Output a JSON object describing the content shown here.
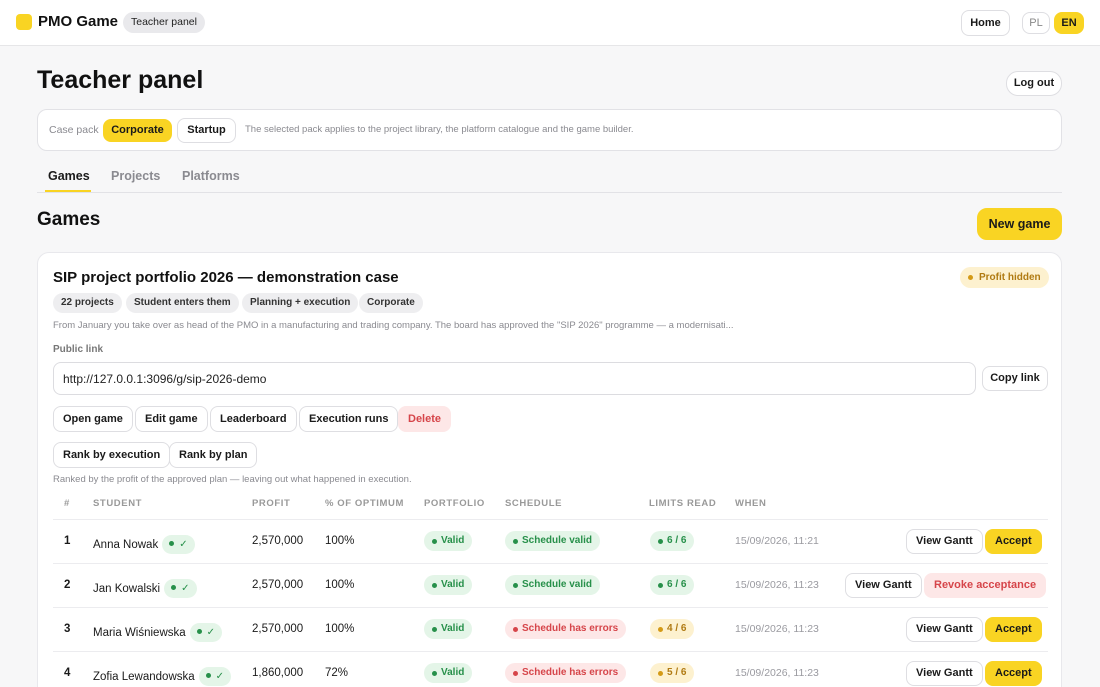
{
  "header": {
    "brand": "PMO Game",
    "panel_tag": "Teacher panel",
    "home": "Home",
    "lang_pl": "PL",
    "lang_en": "EN"
  },
  "page": {
    "title": "Teacher panel",
    "logout": "Log out"
  },
  "case_pack": {
    "label": "Case pack",
    "options": [
      "Corporate",
      "Startup"
    ],
    "selected": "Corporate",
    "note": "The selected pack applies to the project library, the platform catalogue and the game builder."
  },
  "tabs": [
    {
      "label": "Games",
      "active": true
    },
    {
      "label": "Projects",
      "active": false
    },
    {
      "label": "Platforms",
      "active": false
    }
  ],
  "games": {
    "title": "Games",
    "new_game": "New game"
  },
  "game": {
    "title": "SIP project portfolio 2026 — demonstration case",
    "profit_badge": "Profit hidden",
    "tags": [
      "22 projects",
      "Student enters them",
      "Planning + execution",
      "Corporate"
    ],
    "description": "From January you take over as head of the PMO in a manufacturing and trading company. The board has approved the \"SIP 2026\" programme — a modernisati...",
    "public_link_label": "Public link",
    "public_link": "http://127.0.0.1:3096/g/sip-2026-demo",
    "copy_link": "Copy link",
    "actions": [
      "Open game",
      "Edit game",
      "Leaderboard",
      "Execution runs",
      "Delete"
    ],
    "rank_buttons": [
      "Rank by execution",
      "Rank by plan"
    ],
    "ranked_note": "Ranked by the profit of the approved plan — leaving out what happened in execution."
  },
  "table": {
    "columns": [
      "#",
      "STUDENT",
      "PROFIT",
      "% OF OPTIMUM",
      "PORTFOLIO",
      "SCHEDULE",
      "LIMITS READ",
      "WHEN"
    ],
    "check_mark": "✓",
    "rows": [
      {
        "rank": "1",
        "student": "Anna Nowak",
        "profit": "2,570,000",
        "optimum": "100%",
        "portfolio": "Valid",
        "schedule": "Schedule valid",
        "schedule_status": "green",
        "limits": "6 / 6",
        "limits_status": "green",
        "when": "15/09/2026, 11:21",
        "view": "View Gantt",
        "action": "Accept",
        "action_type": "accept"
      },
      {
        "rank": "2",
        "student": "Jan Kowalski",
        "profit": "2,570,000",
        "optimum": "100%",
        "portfolio": "Valid",
        "schedule": "Schedule valid",
        "schedule_status": "green",
        "limits": "6 / 6",
        "limits_status": "green",
        "when": "15/09/2026, 11:23",
        "view": "View Gantt",
        "action": "Revoke acceptance",
        "action_type": "revoke"
      },
      {
        "rank": "3",
        "student": "Maria Wiśniewska",
        "profit": "2,570,000",
        "optimum": "100%",
        "portfolio": "Valid",
        "schedule": "Schedule has errors",
        "schedule_status": "red",
        "limits": "4 / 6",
        "limits_status": "amber",
        "when": "15/09/2026, 11:23",
        "view": "View Gantt",
        "action": "Accept",
        "action_type": "accept"
      },
      {
        "rank": "4",
        "student": "Zofia Lewandowska",
        "profit": "1,860,000",
        "optimum": "72%",
        "portfolio": "Valid",
        "schedule": "Schedule has errors",
        "schedule_status": "red",
        "limits": "5 / 6",
        "limits_status": "amber",
        "when": "15/09/2026, 11:23",
        "view": "View Gantt",
        "action": "Accept",
        "action_type": "accept"
      }
    ]
  },
  "colors": {
    "accent": "#f9d423",
    "success": "#27904a",
    "danger": "#d6454a",
    "warning": "#b07a12"
  }
}
